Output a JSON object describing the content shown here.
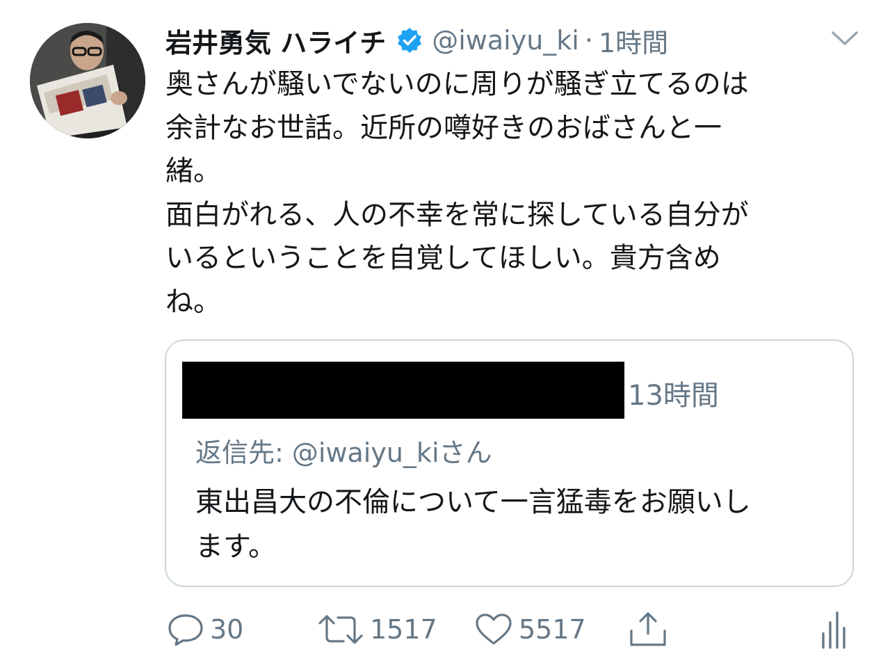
{
  "tweet": {
    "author": {
      "display_name": "岩井勇気 ハライチ",
      "handle": "@iwaiyu_ki",
      "separator": "·",
      "time": "1時間",
      "verified": true
    },
    "text": "奥さんが騒いでないのに周りが騒ぎ立てるのは\n余計なお世話。近所の噂好きのおばさんと一\n緒。\n面白がれる、人の不幸を常に探している自分が\nいるということを自覚してほしい。貴方含め\nね。",
    "quoted": {
      "time": "13時間",
      "reply_to": "返信先: @iwaiyu_kiさん",
      "text": "東出昌大の不倫について一言猛毒をお願いし\nます。"
    },
    "actions": {
      "reply_count": "30",
      "retweet_count": "1517",
      "like_count": "5517"
    }
  },
  "icons": {
    "verified": "verified-badge-icon",
    "menu": "chevron-down-icon",
    "reply": "reply-icon",
    "retweet": "retweet-icon",
    "like": "heart-icon",
    "share": "share-icon",
    "analytics": "analytics-icon"
  },
  "colors": {
    "verified": "#1da1f2",
    "secondary_text": "#657786",
    "border": "#ccd6dd"
  }
}
